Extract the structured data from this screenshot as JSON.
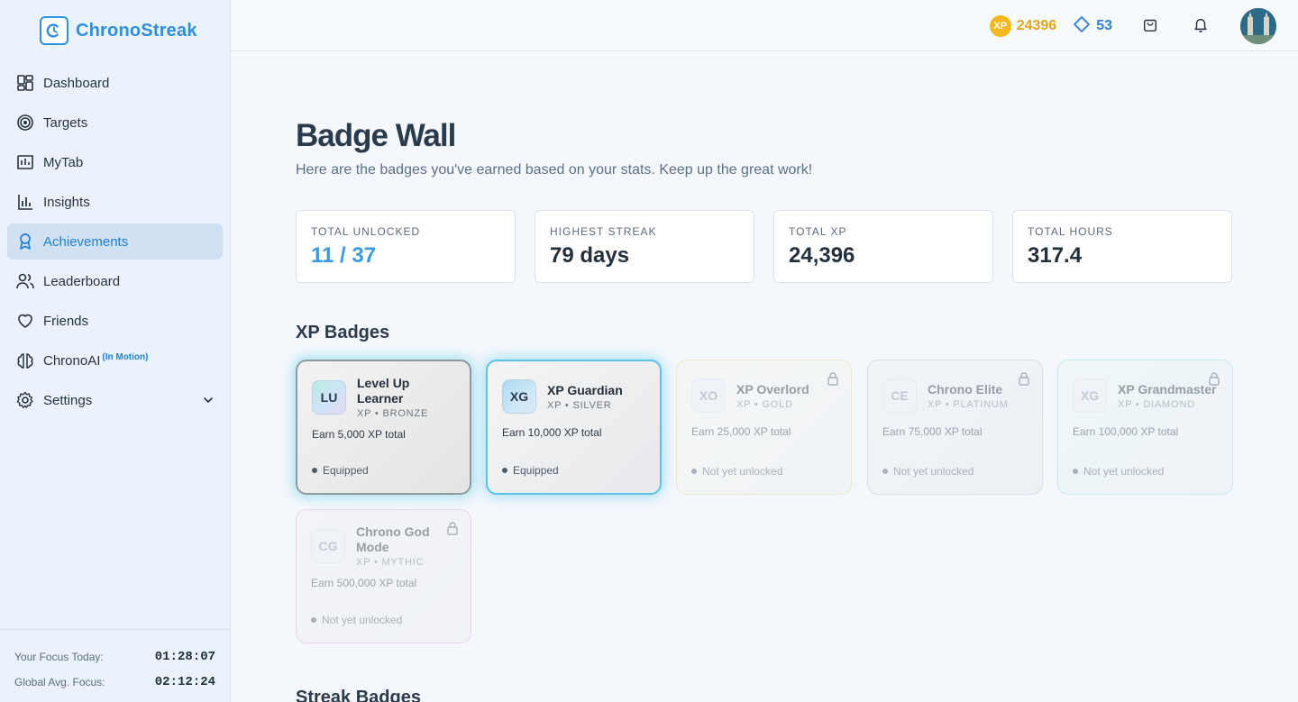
{
  "brand": {
    "name": "ChronoStreak"
  },
  "sidebar": {
    "items": [
      {
        "label": "Dashboard",
        "icon": "grid-icon"
      },
      {
        "label": "Targets",
        "icon": "target-icon"
      },
      {
        "label": "MyTab",
        "icon": "chart-box-icon"
      },
      {
        "label": "Insights",
        "icon": "bar-chart-icon"
      },
      {
        "label": "Achievements",
        "icon": "award-icon",
        "active": true
      },
      {
        "label": "Leaderboard",
        "icon": "users-icon"
      },
      {
        "label": "Friends",
        "icon": "heart-icon"
      },
      {
        "label": "ChronoAI",
        "icon": "brain-icon",
        "tag": "(In Motion)"
      },
      {
        "label": "Settings",
        "icon": "gear-icon"
      }
    ],
    "footer": {
      "focus_today_label": "Your Focus Today:",
      "focus_today_value": "01:28:07",
      "global_avg_label": "Global Avg. Focus:",
      "global_avg_value": "02:12:24"
    }
  },
  "topbar": {
    "xp_coin_label": "XP",
    "xp_value": "24396",
    "gems_value": "53"
  },
  "page": {
    "title": "Badge Wall",
    "subtitle": "Here are the badges you've earned based on your stats. Keep up the great work!"
  },
  "stats": [
    {
      "label": "TOTAL UNLOCKED",
      "value": "11 / 37"
    },
    {
      "label": "HIGHEST STREAK",
      "value": "79 days"
    },
    {
      "label": "TOTAL XP",
      "value": "24,396"
    },
    {
      "label": "TOTAL HOURS",
      "value": "317.4"
    }
  ],
  "sections": {
    "xp_title": "XP Badges",
    "streak_title": "Streak Badges"
  },
  "badges": [
    {
      "mono": "LU",
      "name": "Level Up Learner",
      "tier": "XP • BRONZE",
      "req": "Earn 5,000 XP total",
      "status": "Equipped"
    },
    {
      "mono": "XG",
      "name": "XP Guardian",
      "tier": "XP • SILVER",
      "req": "Earn 10,000 XP total",
      "status": "Equipped"
    },
    {
      "mono": "XO",
      "name": "XP Overlord",
      "tier": "XP • GOLD",
      "req": "Earn 25,000 XP total",
      "status": "Not yet unlocked"
    },
    {
      "mono": "CE",
      "name": "Chrono Elite",
      "tier": "XP • PLATINUM",
      "req": "Earn 75,000 XP total",
      "status": "Not yet unlocked"
    },
    {
      "mono": "XG",
      "name": "XP Grandmaster",
      "tier": "XP • DIAMOND",
      "req": "Earn 100,000 XP total",
      "status": "Not yet unlocked"
    },
    {
      "mono": "CG",
      "name": "Chrono God Mode",
      "tier": "XP • MYTHIC",
      "req": "Earn 500,000 XP total",
      "status": "Not yet unlocked"
    }
  ]
}
